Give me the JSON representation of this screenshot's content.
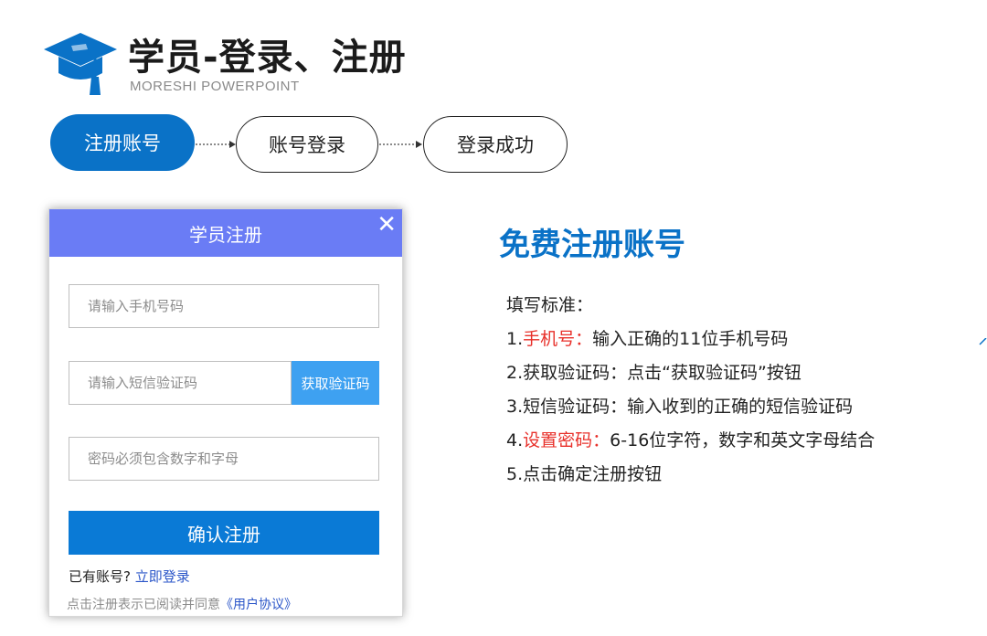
{
  "header": {
    "title": "学员-登录、注册",
    "subtitle": "MORESHI POWERPOINT"
  },
  "steps": [
    {
      "label": "注册账号",
      "active": true
    },
    {
      "label": "账号登录",
      "active": false
    },
    {
      "label": "登录成功",
      "active": false
    }
  ],
  "dialog": {
    "title": "学员注册",
    "close_glyph": "✕",
    "phone_placeholder": "请输入手机号码",
    "code_placeholder": "请输入短信验证码",
    "get_code_label": "获取验证码",
    "password_placeholder": "密码必须包含数字和字母",
    "submit_label": "确认注册",
    "has_account_text": "已有账号?",
    "login_link": "立即登录",
    "agree_text": "点击注册表示已阅读并同意",
    "agreement_link": "《用户协议》"
  },
  "info": {
    "title": "免费注册账号",
    "intro": "填写标准：",
    "items": [
      {
        "prefix": "1.",
        "highlight": "手机号：",
        "text": "输入正确的11位手机号码"
      },
      {
        "prefix": "2.",
        "highlight": "",
        "text": "获取验证码：点击“获取验证码”按钮"
      },
      {
        "prefix": "3.",
        "highlight": "",
        "text": "短信验证码：输入收到的正确的短信验证码"
      },
      {
        "prefix": "4.",
        "highlight": "设置密码：",
        "text": "6-16位字符，数字和英文字母结合"
      },
      {
        "prefix": "5.",
        "highlight": "",
        "text": "点击确定注册按钮"
      }
    ]
  },
  "colors": {
    "brand_blue": "#0a72c7",
    "dialog_header": "#6a7cf5",
    "code_button": "#3ea1f1",
    "submit_button": "#0a7ad6",
    "highlight_red": "#e8302a",
    "link_blue": "#2a55c8"
  },
  "icons": {
    "logo": "graduation-cap-icon",
    "close": "close-icon"
  }
}
